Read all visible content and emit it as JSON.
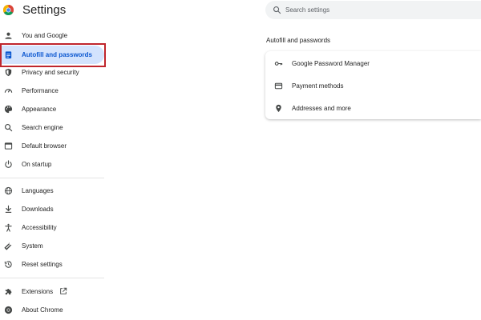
{
  "app": {
    "title": "Settings",
    "logo_icon": "chrome-logo-icon"
  },
  "search": {
    "placeholder": "Search settings",
    "icon": "search-icon"
  },
  "sidebar": {
    "groups": [
      [
        {
          "label": "You and Google",
          "icon": "person-icon",
          "active": false
        },
        {
          "label": "Autofill and passwords",
          "icon": "clipboard-icon",
          "active": true,
          "highlighted": true
        },
        {
          "label": "Privacy and security",
          "icon": "shield-icon",
          "active": false
        },
        {
          "label": "Performance",
          "icon": "speedometer-icon",
          "active": false
        },
        {
          "label": "Appearance",
          "icon": "palette-icon",
          "active": false
        },
        {
          "label": "Search engine",
          "icon": "search-icon",
          "active": false
        },
        {
          "label": "Default browser",
          "icon": "browser-icon",
          "active": false
        },
        {
          "label": "On startup",
          "icon": "power-icon",
          "active": false
        }
      ],
      [
        {
          "label": "Languages",
          "icon": "globe-icon",
          "active": false
        },
        {
          "label": "Downloads",
          "icon": "download-icon",
          "active": false
        },
        {
          "label": "Accessibility",
          "icon": "accessibility-icon",
          "active": false
        },
        {
          "label": "System",
          "icon": "wrench-icon",
          "active": false
        },
        {
          "label": "Reset settings",
          "icon": "history-icon",
          "active": false
        }
      ],
      [
        {
          "label": "Extensions",
          "icon": "puzzle-icon",
          "active": false,
          "external_link_icon": "open-in-new-icon"
        },
        {
          "label": "About Chrome",
          "icon": "chrome-logo-icon",
          "active": false
        }
      ]
    ]
  },
  "main": {
    "section_title": "Autofill and passwords",
    "rows": [
      {
        "label": "Google Password Manager",
        "icon": "key-icon"
      },
      {
        "label": "Payment methods",
        "icon": "credit-card-icon"
      },
      {
        "label": "Addresses and more",
        "icon": "location-pin-icon"
      }
    ]
  },
  "colors": {
    "accent": "#0b57d0",
    "active_bg": "#d3e3fd",
    "highlight_border": "#c0262d",
    "search_bg": "#f1f3f4"
  }
}
